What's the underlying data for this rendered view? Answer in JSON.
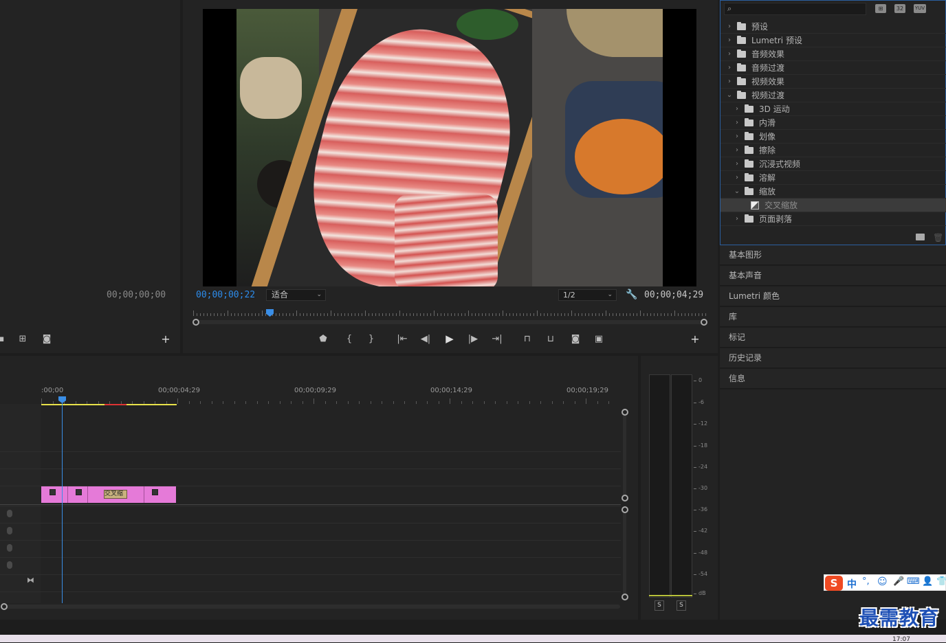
{
  "source_monitor": {
    "timecode": "00;00;00;00"
  },
  "program_monitor": {
    "current_time": "00;00;00;22",
    "fit_label": "适合",
    "resolution": "1/2",
    "duration": "00;00;04;29",
    "playhead_fraction": 0.155
  },
  "timeline": {
    "ruler_labels": [
      ":00;00",
      "00;00;04;29",
      "00;00;09;29",
      "00;00;14;29",
      "00;00;19;29"
    ],
    "clip_label": "交叉缩"
  },
  "effects": {
    "search_placeholder": "",
    "header_icons": [
      "32",
      "YUV"
    ],
    "tree": [
      {
        "label": "预设",
        "level": 0,
        "expanded": false
      },
      {
        "label": "Lumetri 预设",
        "level": 0,
        "expanded": false
      },
      {
        "label": "音频效果",
        "level": 0,
        "expanded": false
      },
      {
        "label": "音频过渡",
        "level": 0,
        "expanded": false
      },
      {
        "label": "视频效果",
        "level": 0,
        "expanded": false
      },
      {
        "label": "视频过渡",
        "level": 0,
        "expanded": true
      },
      {
        "label": "3D 运动",
        "level": 1,
        "expanded": false
      },
      {
        "label": "内滑",
        "level": 1,
        "expanded": false
      },
      {
        "label": "划像",
        "level": 1,
        "expanded": false
      },
      {
        "label": "擦除",
        "level": 1,
        "expanded": false
      },
      {
        "label": "沉浸式视频",
        "level": 1,
        "expanded": false
      },
      {
        "label": "溶解",
        "level": 1,
        "expanded": false
      },
      {
        "label": "缩放",
        "level": 1,
        "expanded": true
      },
      {
        "label": "交叉缩放",
        "level": 2,
        "selected": true
      },
      {
        "label": "页面剥落",
        "level": 1,
        "expanded": false
      }
    ]
  },
  "side_panels": [
    "基本图形",
    "基本声音",
    "Lumetri 颜色",
    "库",
    "标记",
    "历史记录",
    "信息"
  ],
  "audio_meter": {
    "db_labels": [
      "0",
      "-6",
      "-12",
      "-18",
      "-24",
      "-30",
      "-36",
      "-42",
      "-48",
      "-54",
      "dB"
    ],
    "solo_labels": [
      "S",
      "S"
    ]
  },
  "ime_bar": {
    "lang": "中"
  },
  "watermark": "最需教育",
  "taskbar_time": "17:07",
  "colors": {
    "timecode_blue": "#2d8ceb",
    "clip_pink": "#e57ad8",
    "playhead_blue": "#3a8ee6",
    "work_area_yellow": "#e8e24a",
    "work_area_red": "#d33"
  }
}
